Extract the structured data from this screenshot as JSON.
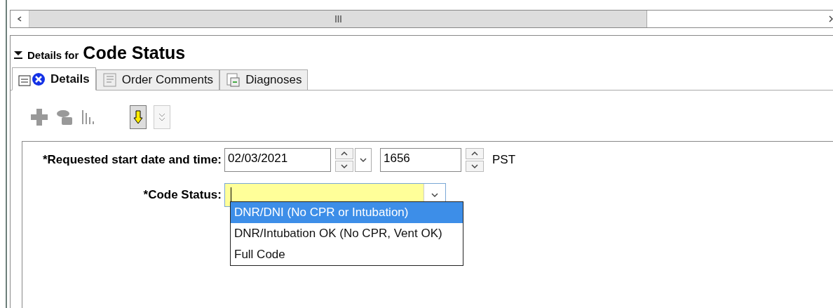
{
  "section": {
    "prefix": "Details for",
    "title": "Code Status",
    "expanded": true
  },
  "tabs": [
    {
      "label": "Details",
      "selected": true,
      "kind": "details"
    },
    {
      "label": "Order Comments",
      "selected": false,
      "kind": "comments"
    },
    {
      "label": "Diagnoses",
      "selected": false,
      "kind": "diagnoses"
    }
  ],
  "form": {
    "start_label": "*Requested start date and time:",
    "date": "02/03/2021",
    "time": "1656",
    "timezone": "PST",
    "code_status_label": "*Code Status:"
  },
  "dropdown": {
    "options": [
      {
        "label": "DNR/DNI (No CPR or Intubation)",
        "selected": true
      },
      {
        "label": "DNR/Intubation OK (No CPR,  Vent OK)",
        "selected": false
      },
      {
        "label": "Full Code",
        "selected": false
      }
    ]
  }
}
